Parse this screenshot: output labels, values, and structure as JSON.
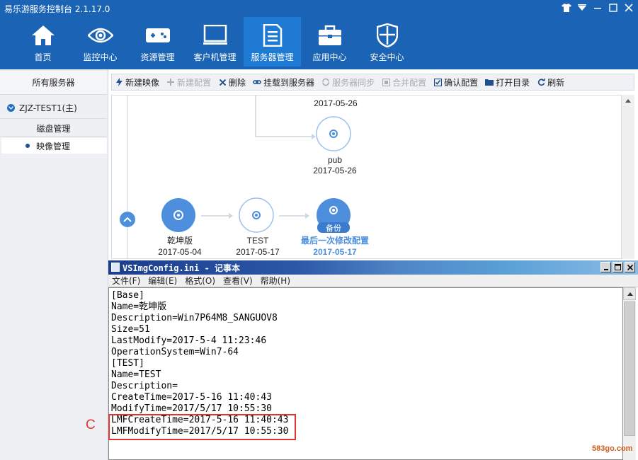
{
  "app": {
    "title": "易乐游服务控制台 2.1.17.0",
    "accent": "#1a63b5",
    "window_buttons": [
      "shirt-icon",
      "menu-icon",
      "minimize-icon",
      "maximize-icon",
      "close-icon"
    ]
  },
  "nav": {
    "items": [
      {
        "label": "首页",
        "icon": "home-icon"
      },
      {
        "label": "监控中心",
        "icon": "eye-icon"
      },
      {
        "label": "资源管理",
        "icon": "gamepad-icon"
      },
      {
        "label": "客户机管理",
        "icon": "monitor-icon"
      },
      {
        "label": "服务器管理",
        "icon": "server-icon",
        "active": true
      },
      {
        "label": "应用中心",
        "icon": "toolbox-icon"
      },
      {
        "label": "安全中心",
        "icon": "shield-icon"
      }
    ]
  },
  "sidebar": {
    "all_servers": "所有服务器",
    "server_name": "ZJZ-TEST1(主)",
    "disk_mgmt": "磁盘管理",
    "image_mgmt": "映像管理"
  },
  "toolbar": {
    "items": [
      {
        "label": "新建映像",
        "icon": "bolt-icon",
        "enabled": true
      },
      {
        "label": "新建配置",
        "icon": "plus-icon",
        "enabled": false
      },
      {
        "label": "删除",
        "icon": "x-icon",
        "enabled": true
      },
      {
        "label": "挂载到服务器",
        "icon": "link-icon",
        "enabled": true
      },
      {
        "label": "服务器同步",
        "icon": "sync-icon",
        "enabled": false
      },
      {
        "label": "合并配置",
        "icon": "merge-icon",
        "enabled": false
      },
      {
        "label": "确认配置",
        "icon": "checkbox-icon",
        "enabled": true
      },
      {
        "label": "打开目录",
        "icon": "folder-icon",
        "enabled": true
      },
      {
        "label": "刷新",
        "icon": "refresh-icon",
        "enabled": true
      }
    ]
  },
  "graph": {
    "top_date": "2017-05-26",
    "pub_node": {
      "name": "pub",
      "date": "2017-05-26"
    },
    "nodes": [
      {
        "name": "乾坤版",
        "date": "2017-05-04",
        "style": "filled"
      },
      {
        "name": "TEST",
        "date": "2017-05-17",
        "style": "outline"
      },
      {
        "name": "最后一次修改配置",
        "date": "2017-05-17",
        "style": "backup",
        "badge": "备份"
      }
    ],
    "node_color": "#4d8fdc"
  },
  "notepad": {
    "title": "VSImgConfig.ini - 记事本",
    "menu": [
      "文件(F)",
      "编辑(E)",
      "格式(O)",
      "查看(V)",
      "帮助(H)"
    ],
    "lines": [
      "[Base]",
      "Name=乾坤版",
      "Description=Win7P64M8_SANGUOV8",
      "Size=51",
      "LastModify=2017-5-4 11:23:46",
      "OperationSystem=Win7-64",
      "[TEST]",
      "Name=TEST",
      "Description=",
      "CreateTime=2017-5-16 11:40:43",
      "ModifyTime=2017/5/17 10:55:30",
      "LMFCreateTime=2017-5-16 11:40:43",
      "LMFModifyTime=2017/5/17 10:55:30"
    ]
  },
  "annotation": {
    "label": "C",
    "color": "#e23232"
  },
  "watermark": "583go.com"
}
